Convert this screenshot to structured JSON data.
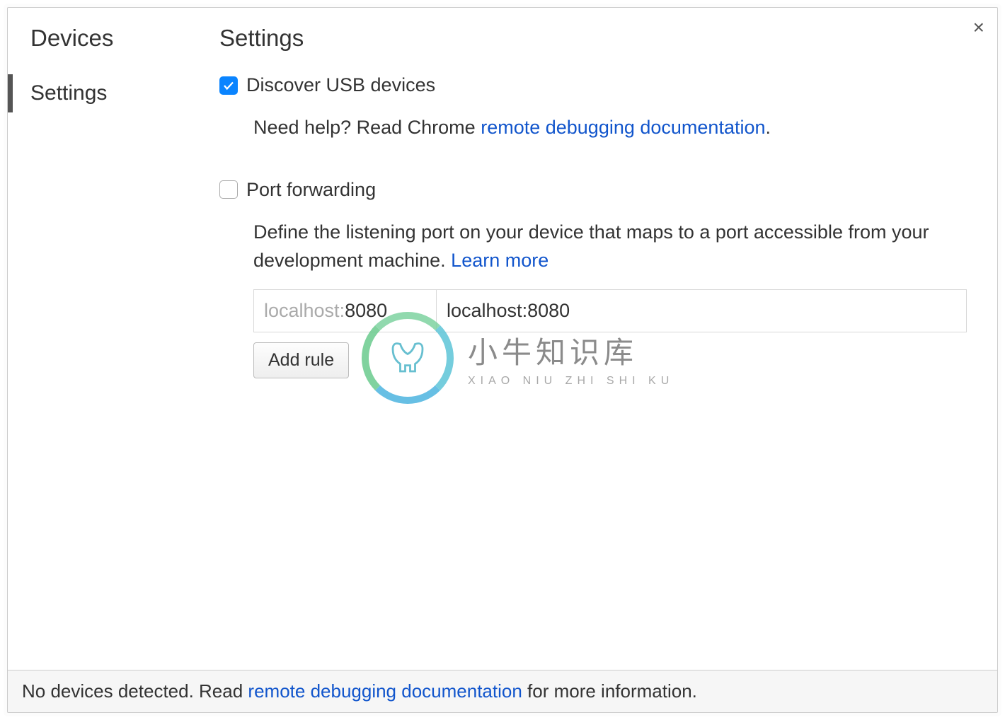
{
  "sidebar": {
    "title": "Devices",
    "nav": {
      "settings": "Settings"
    }
  },
  "page": {
    "title": "Settings"
  },
  "discover": {
    "checked": true,
    "label": "Discover USB devices",
    "help_prefix": "Need help? Read Chrome ",
    "help_link": "remote debugging documentation",
    "help_suffix": "."
  },
  "port_forwarding": {
    "checked": false,
    "label": "Port forwarding",
    "description": "Define the listening port on your device that maps to a port accessible from your development machine. ",
    "learn_more": "Learn more",
    "rule": {
      "device_port_placeholder_prefix": "localhost:",
      "device_port_value": "8080",
      "local_address": "localhost:8080"
    },
    "add_rule_label": "Add rule"
  },
  "footer": {
    "prefix": "No devices detected. Read ",
    "link": "remote debugging documentation",
    "suffix": " for more information."
  },
  "watermark": {
    "cn": "小牛知识库",
    "en": "XIAO NIU ZHI SHI KU"
  }
}
